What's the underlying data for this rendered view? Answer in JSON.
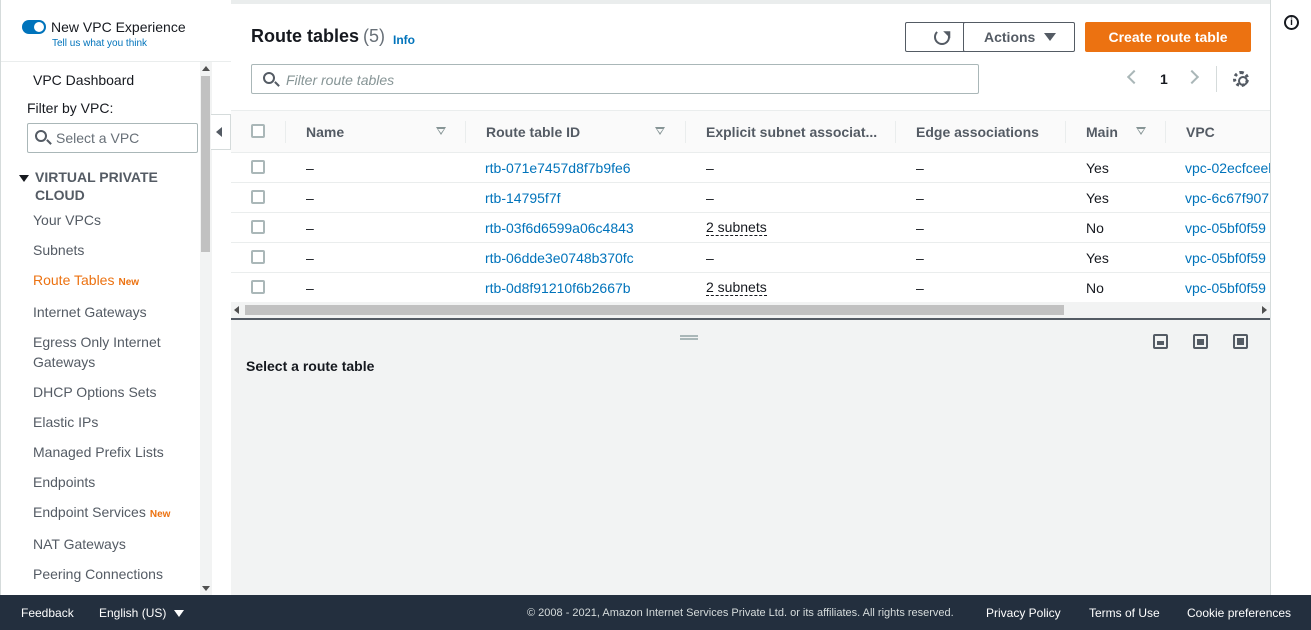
{
  "sidebar": {
    "toggle_label": "New VPC Experience",
    "toggle_sub": "Tell us what you think",
    "dashboard": "VPC Dashboard",
    "filter_label": "Filter by VPC:",
    "filter_placeholder": "Select a VPC",
    "section": "VIRTUAL PRIVATE CLOUD",
    "items": [
      {
        "label": "Your VPCs"
      },
      {
        "label": "Subnets"
      },
      {
        "label": "Route Tables",
        "badge": "New",
        "active": true
      },
      {
        "label": "Internet Gateways"
      },
      {
        "label": "Egress Only Internet Gateways"
      },
      {
        "label": "DHCP Options Sets"
      },
      {
        "label": "Elastic IPs"
      },
      {
        "label": "Managed Prefix Lists"
      },
      {
        "label": "Endpoints"
      },
      {
        "label": "Endpoint Services",
        "badge": "New"
      },
      {
        "label": "NAT Gateways"
      },
      {
        "label": "Peering Connections"
      }
    ]
  },
  "header": {
    "title": "Route tables",
    "count": "(5)",
    "info": "Info",
    "actions_label": "Actions",
    "create_label": "Create route table"
  },
  "filter": {
    "placeholder": "Filter route tables"
  },
  "pagination": {
    "page": "1"
  },
  "table": {
    "columns": [
      "Name",
      "Route table ID",
      "Explicit subnet associat...",
      "Edge associations",
      "Main",
      "VPC"
    ],
    "rows": [
      {
        "name": "–",
        "id": "rtb-071e7457d8f7b9fe6",
        "subnets": "–",
        "edge": "–",
        "main": "Yes",
        "vpc": "vpc-02ecfceel"
      },
      {
        "name": "–",
        "id": "rtb-14795f7f",
        "subnets": "–",
        "edge": "–",
        "main": "Yes",
        "vpc": "vpc-6c67f907"
      },
      {
        "name": "–",
        "id": "rtb-03f6d6599a06c4843",
        "subnets": "2 subnets",
        "edge": "–",
        "main": "No",
        "vpc": "vpc-05bf0f59"
      },
      {
        "name": "–",
        "id": "rtb-06dde3e0748b370fc",
        "subnets": "–",
        "edge": "–",
        "main": "Yes",
        "vpc": "vpc-05bf0f59"
      },
      {
        "name": "–",
        "id": "rtb-0d8f91210f6b2667b",
        "subnets": "2 subnets",
        "edge": "–",
        "main": "No",
        "vpc": "vpc-05bf0f59"
      }
    ]
  },
  "detail": {
    "empty_text": "Select a route table"
  },
  "footer": {
    "feedback": "Feedback",
    "language": "English (US)",
    "copyright": "© 2008 - 2021, Amazon Internet Services Private Ltd. or its affiliates. All rights reserved.",
    "privacy": "Privacy Policy",
    "terms": "Terms of Use",
    "cookies": "Cookie preferences"
  },
  "colors": {
    "accent": "#ec7211",
    "link": "#0073bb",
    "footer_bg": "#232f3e"
  }
}
